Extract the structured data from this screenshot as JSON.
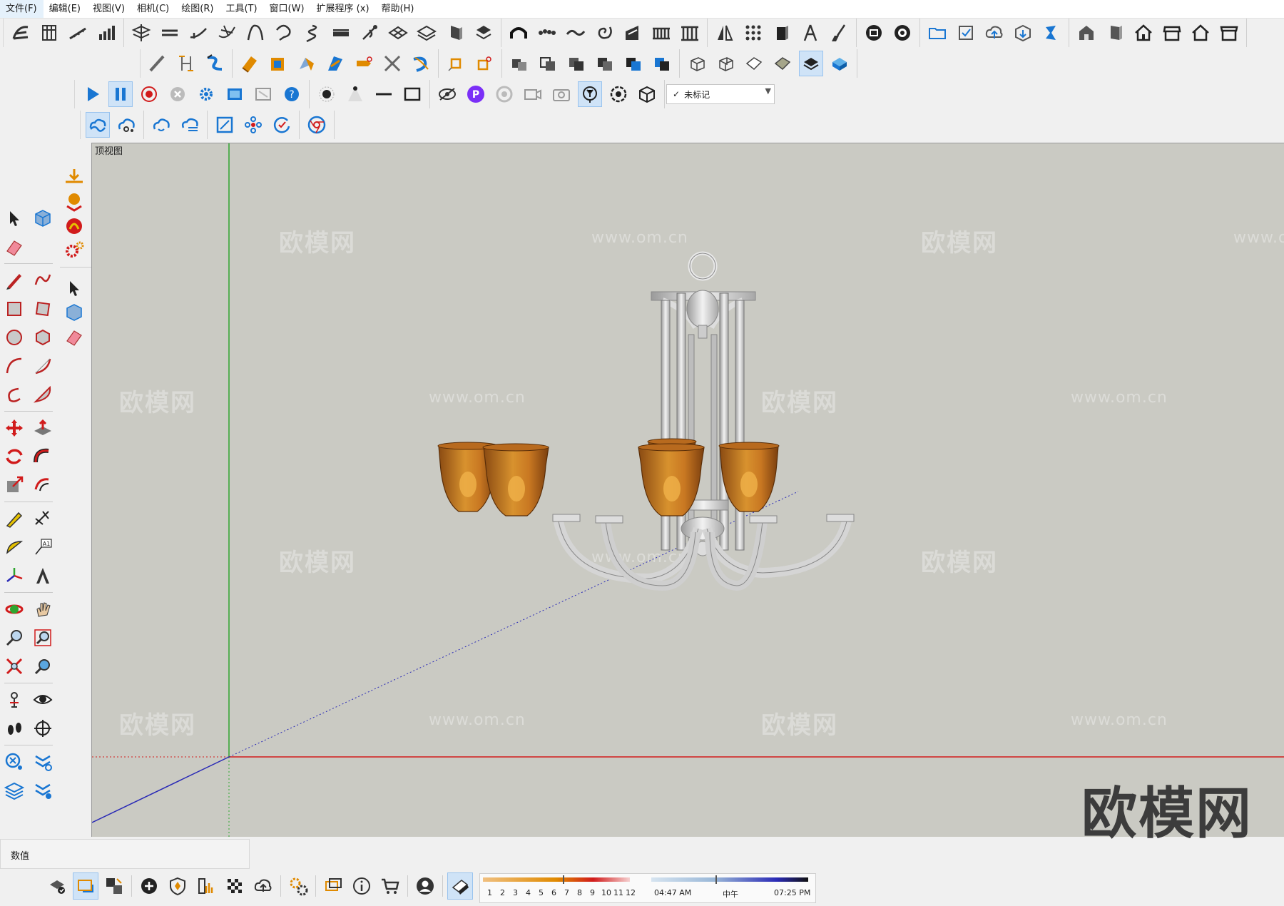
{
  "menu": [
    "文件(F)",
    "编辑(E)",
    "视图(V)",
    "相机(C)",
    "绘图(R)",
    "工具(T)",
    "窗口(W)",
    "扩展程序 (x)",
    "帮助(H)"
  ],
  "tag_selector": {
    "check": "✓",
    "value": "未标记"
  },
  "scene_tab": "顶视图",
  "measurements_label": "数值",
  "watermarks": {
    "brand": "欧模网",
    "url": "www.om.cn",
    "big_logo": "欧模网"
  },
  "shadow": {
    "months": [
      "1",
      "2",
      "3",
      "4",
      "5",
      "6",
      "7",
      "8",
      "9",
      "10",
      "11",
      "12"
    ],
    "sunrise": "04:47 AM",
    "noon": "中午",
    "sunset": "07:25 PM"
  },
  "colors": {
    "viewport_bg": "#cacac3",
    "axis_red": "#d11b1b",
    "axis_green": "#2fa52f",
    "axis_blue": "#2a2ab6",
    "shade_amber": "#c9782a",
    "metal": "#d8d8d8",
    "accent_blue": "#1976d2"
  },
  "icons": {
    "toolbar_row1": [
      "sandbox-icon",
      "wall-icon",
      "stairs-icon",
      "bar-chart-icon",
      "layers-plate-icon",
      "line-split-icon",
      "curve-icon",
      "bezier-icon",
      "arc-shape-icon",
      "loop-icon",
      "spring-icon",
      "slab-icon",
      "pen-node-icon",
      "grid-plane-icon",
      "stack-plane-icon",
      "column-icon",
      "flip-icon",
      "arch-icon",
      "beads-icon",
      "wave-icon",
      "spiral-icon",
      "ramp-icon",
      "balustrade-icon",
      "colonnade-icon",
      "mirror-icon",
      "array-icon",
      "panel-icon",
      "compass-icon",
      "brush-icon",
      "film-icon",
      "film-record-icon",
      "folder-icon",
      "checklist-icon",
      "cloud-upload-icon",
      "box-download-icon",
      "warehouse-icon",
      "house-3d-icon",
      "cabinet-icon",
      "home-icon",
      "shop-icon",
      "home-outline-icon",
      "store-icon"
    ],
    "toolbar_row2": [
      "pencil-edge-icon",
      "dimension-icon",
      "follow-me-icon",
      "offset-solid-icon",
      "push-box-icon",
      "cone-icon",
      "sweep-icon",
      "ruler-cut-icon",
      "cross-cut-icon",
      "loft-icon",
      "scale-box-icon",
      "rotate-box-icon",
      "cubes-icon",
      "union-icon",
      "subtract-icon",
      "intersect-icon",
      "trim-icon",
      "split-icon",
      "box-wire-icon",
      "box-wire2-icon",
      "box-face-icon",
      "box-shaded-icon",
      "stack-dark-icon",
      "box-blue-icon"
    ],
    "toolbar_row3": [
      "play-icon",
      "pause-icon",
      "record-icon",
      "stop-icon",
      "settings-icon",
      "video-icon",
      "video-off-icon",
      "help-icon",
      "dot-icon",
      "cone-light-icon",
      "line-icon",
      "rect-icon",
      "hide-icon",
      "p-plugin-icon",
      "ring-icon",
      "camera-video-icon",
      "camera-icon",
      "y-tool-icon",
      "flower-icon",
      "box-down-icon"
    ],
    "toolbar_row4": [
      "cloud-line-icon",
      "cloud-node-icon",
      "cloud-refresh-icon",
      "cloud-list-icon",
      "resize-icon",
      "dots-cluster-icon",
      "refresh-check-icon",
      "chrome-icon"
    ]
  }
}
